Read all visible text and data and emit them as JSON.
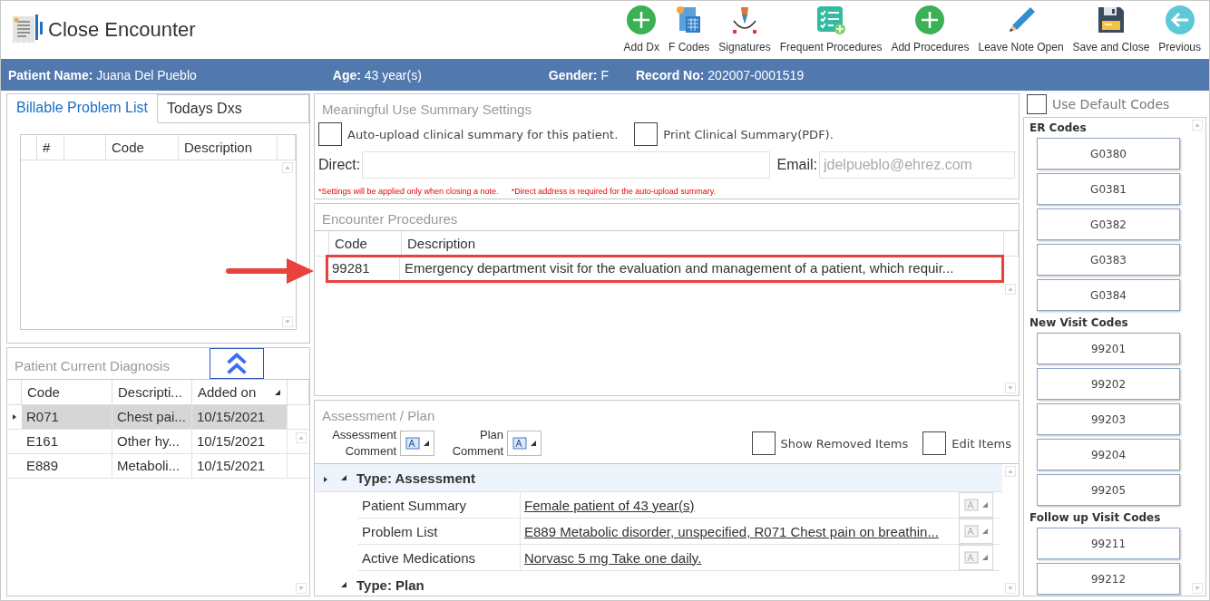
{
  "window": {
    "title": "Close Encounter"
  },
  "toolbar": [
    {
      "label": "Add Dx",
      "kind": "plus"
    },
    {
      "label": "F Codes",
      "kind": "calculator"
    },
    {
      "label": "Signatures",
      "kind": "pen"
    },
    {
      "label": "Frequent Procedures",
      "kind": "checklist"
    },
    {
      "label": "Add Procedures",
      "kind": "plus"
    },
    {
      "label": "Leave Note Open",
      "kind": "pencil"
    },
    {
      "label": "Save and Close",
      "kind": "save"
    },
    {
      "label": "Previous",
      "kind": "back"
    }
  ],
  "patient_bar": [
    {
      "label": "Patient Name:",
      "value": "Juana Del Pueblo"
    },
    {
      "label": "Age:",
      "value": "43 year(s)"
    },
    {
      "label": "Gender:",
      "value": "F"
    },
    {
      "label": "Record No:",
      "value": "202007-0001519"
    }
  ],
  "left_tabs": [
    {
      "label": "Billable Problem List",
      "selected": true
    },
    {
      "label": "Todays Dxs",
      "selected": false
    }
  ],
  "billable_grid": {
    "columns": [
      "#",
      "Code",
      "Description"
    ]
  },
  "current_diagnosis": {
    "title": "Patient Current Diagnosis",
    "columns": [
      "Code",
      "Descripti...",
      "Added on"
    ],
    "rows": [
      {
        "code": "R071",
        "description": "Chest pai...",
        "added_on": "10/15/2021",
        "selected": true
      },
      {
        "code": "E161",
        "description": "Other hy...",
        "added_on": "10/15/2021",
        "selected": false
      },
      {
        "code": "E889",
        "description": "Metaboli...",
        "added_on": "10/15/2021",
        "selected": false
      }
    ]
  },
  "meaningful_use": {
    "title": "Meaningful Use Summary Settings",
    "checkboxes": [
      {
        "label": "Auto-upload clinical summary for this patient.",
        "checked": false
      },
      {
        "label": "Print Clinical Summary(PDF).",
        "checked": false
      }
    ],
    "direct": {
      "label": "Direct:"
    },
    "email": {
      "label": "Email:",
      "placeholder": "jdelpueblo@ehrez.com"
    },
    "notes": [
      "*Settings will be applied only when closing a note.",
      "*Direct address is required for the auto-upload summary."
    ]
  },
  "encounter_procedures": {
    "title": "Encounter Procedures",
    "columns": [
      "Code",
      "Description"
    ],
    "rows": [
      {
        "code": "99281",
        "description": "Emergency department visit for the evaluation and management of a patient, which requir...",
        "highlighted": true
      }
    ]
  },
  "assessment_plan": {
    "title": "Assessment / Plan",
    "comments": [
      {
        "label": "Assessment Comment"
      },
      {
        "label": "Plan Comment"
      }
    ],
    "checkboxes": [
      {
        "label": "Show Removed Items",
        "checked": false
      },
      {
        "label": "Edit Items",
        "checked": false
      }
    ],
    "groups": [
      {
        "title": "Type: Assessment",
        "expanded": true,
        "items": [
          {
            "label": "Patient Summary",
            "value": "Female patient of 43 year(s)"
          },
          {
            "label": "Problem List",
            "value": "E889 Metabolic disorder, unspecified, R071 Chest pain on breathin..."
          },
          {
            "label": "Active Medications",
            "value": "Norvasc 5 mg Take one daily."
          }
        ]
      },
      {
        "title": "Type: Plan",
        "expanded": true
      }
    ]
  },
  "codes_panel": {
    "use_default": {
      "label": "Use Default Codes",
      "checked": false
    },
    "sections": [
      {
        "title": "ER Codes",
        "codes": [
          "G0380",
          "G0381",
          "G0382",
          "G0383",
          "G0384"
        ]
      },
      {
        "title": "New Visit Codes",
        "codes": [
          "99201",
          "99202",
          "99203",
          "99204",
          "99205"
        ]
      },
      {
        "title": "Follow up Visit Codes",
        "codes": [
          "99211",
          "99212"
        ]
      }
    ]
  }
}
